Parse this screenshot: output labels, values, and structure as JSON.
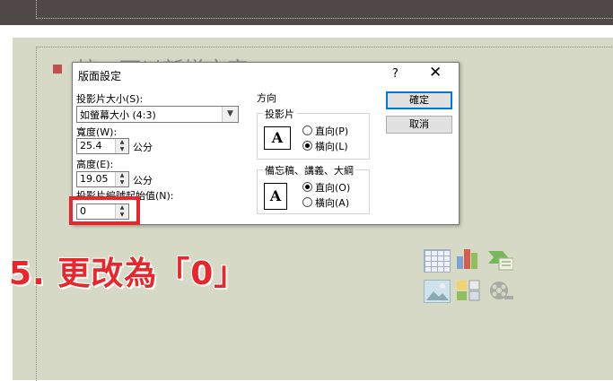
{
  "slide": {
    "title_ghost": "按一下以新增文字"
  },
  "dialog": {
    "title": "版面設定",
    "help": "?",
    "close": "✕",
    "slide_size_label": "投影片大小(S):",
    "slide_size_value": "如螢幕大小 (4:3)",
    "width_label": "寬度(W):",
    "width_value": "25.4",
    "width_unit": "公分",
    "height_label": "高度(E):",
    "height_value": "19.05",
    "height_unit": "公分",
    "number_label": "投影片編號起始值(N):",
    "number_value": "0",
    "orientation_group": "方向",
    "slides_group": "投影片",
    "slides_portrait": "直向(P)",
    "slides_landscape": "橫向(L)",
    "slides_selected": "landscape",
    "notes_group": "備忘稿、講義、大綱",
    "notes_portrait": "直向(O)",
    "notes_landscape": "橫向(A)",
    "notes_selected": "portrait",
    "orient_glyph": "A",
    "ok": "確定",
    "cancel": "取消"
  },
  "callout": {
    "text": "5. 更改為「0」",
    "color": "#e8262c"
  },
  "content_icons": [
    "table-icon",
    "chart-icon",
    "smartart-icon",
    "picture-icon",
    "clip-art-icon",
    "media-icon"
  ]
}
